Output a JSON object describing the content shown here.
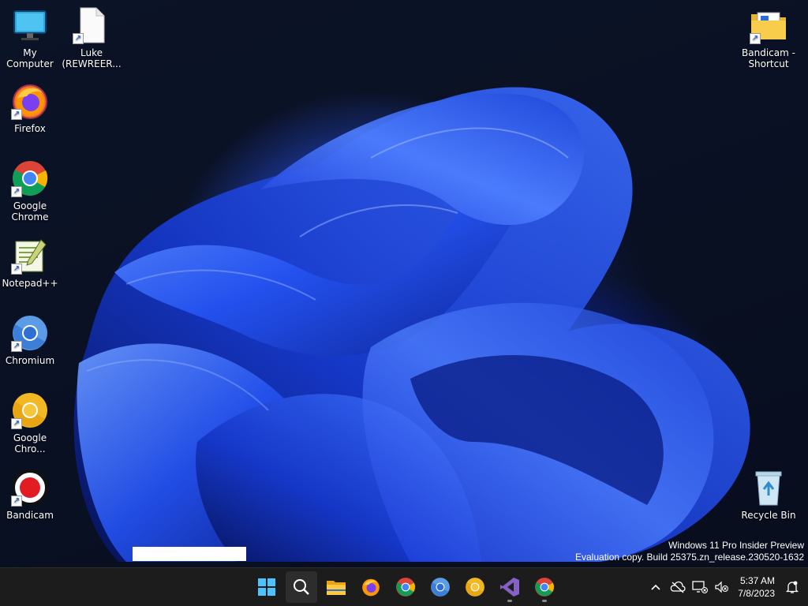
{
  "desktop": {
    "icons": [
      {
        "label": "My Computer"
      },
      {
        "label": "Luke (REWREER..."
      },
      {
        "label": "Firefox"
      },
      {
        "label": "Google Chrome"
      },
      {
        "label": "Notepad++"
      },
      {
        "label": "Chromium"
      },
      {
        "label": "Google Chro..."
      },
      {
        "label": "Bandicam"
      },
      {
        "label": "Bandicam - Shortcut"
      },
      {
        "label": "Recycle Bin"
      }
    ]
  },
  "watermark": {
    "line1": "Windows 11 Pro Insider Preview",
    "line2": "Evaluation copy. Build 25375.zn_release.230520-1632"
  },
  "taskbar": {
    "apps": [
      {
        "icon": "windows-start-icon"
      },
      {
        "icon": "search-icon"
      },
      {
        "icon": "file-explorer-icon"
      },
      {
        "icon": "firefox-icon"
      },
      {
        "icon": "chrome-icon"
      },
      {
        "icon": "chromium-icon"
      },
      {
        "icon": "chrome-canary-icon"
      },
      {
        "icon": "visual-studio-icon"
      },
      {
        "icon": "chrome-icon"
      }
    ],
    "tray": {
      "time": "5:37 AM",
      "date": "7/8/2023"
    }
  },
  "colors": {
    "taskbar_bg": "#1c1c1c",
    "wallpaper_accent": "#2f5bff",
    "bandicam_red": "#e31b23"
  }
}
